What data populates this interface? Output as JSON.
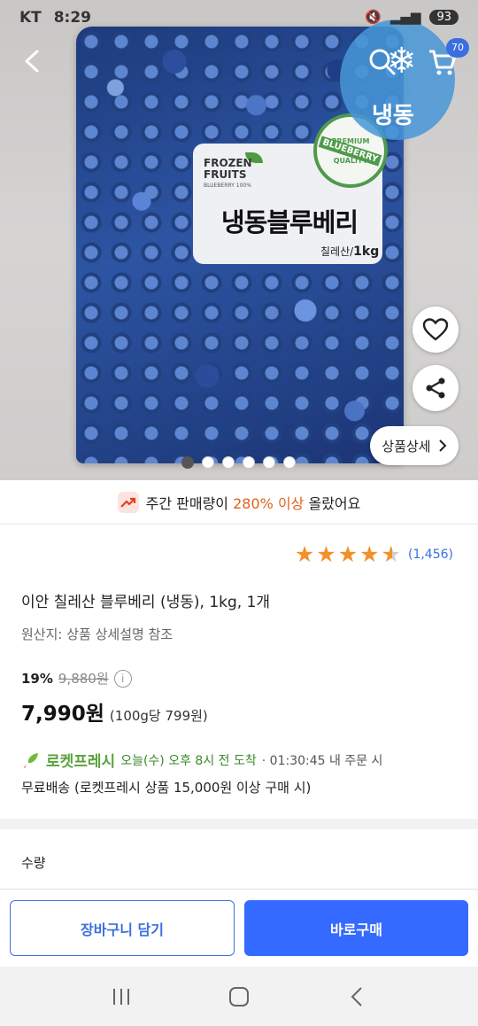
{
  "status_bar": {
    "carrier": "KT",
    "time": "8:29",
    "battery": "93"
  },
  "header": {
    "cart_badge_count": "70"
  },
  "hero": {
    "bag_brand": "FROZEN\nFRUITS",
    "bag_sub": "BLUEBERRY 100%",
    "bag_product_name": "냉동블루베리",
    "bag_origin": "칠레산/",
    "bag_weight": "1kg",
    "premium_top": "PREMIUM",
    "premium_mid": "BLUEBERRY",
    "premium_bottom": "QUALITY",
    "freeze_label": "냉동",
    "detail_button": "상품상세",
    "carousel_total": 6,
    "carousel_active": 1
  },
  "sales_banner": {
    "prefix": "주간 판매량이 ",
    "highlight": "280% 이상",
    "suffix": " 올랐어요"
  },
  "rating": {
    "stars": 4.5,
    "review_count": "(1,456)"
  },
  "product": {
    "title": "이안 칠레산 블루베리 (냉동), 1kg, 1개",
    "origin": "원산지: 상품 상세설명 참조",
    "discount_rate": "19%",
    "original_price": "9,880원",
    "price": "7,990원",
    "unit_price": "(100g당 799원)"
  },
  "delivery": {
    "brand": "로켓프레시",
    "arrival": "오늘(수) 오후 8시 전 도착",
    "order_deadline": " · 01:30:45 내 주문 시",
    "shipping_info": "무료배송 (로켓프레시 상품 15,000원 이상 구매 시)"
  },
  "quantity": {
    "label": "수량"
  },
  "actions": {
    "add_to_cart": "장바구니 담기",
    "buy_now": "바로구매"
  },
  "colors": {
    "accent_blue": "#346aff",
    "rocket_green": "#5aa23b",
    "highlight_orange": "#e2611a",
    "star_orange": "#f4902a"
  }
}
